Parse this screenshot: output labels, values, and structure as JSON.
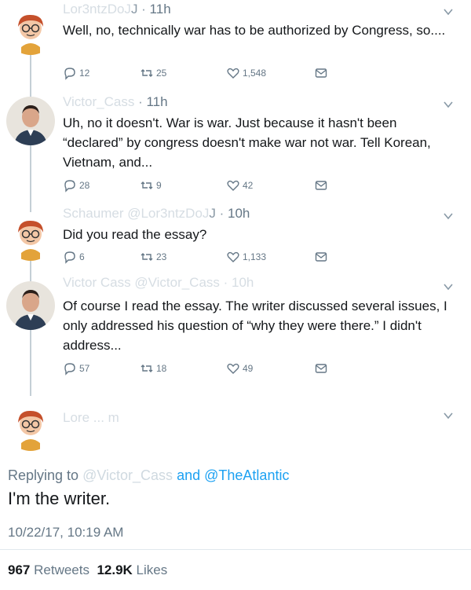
{
  "tweets": [
    {
      "header_blur": "Lor3ntzDoJ",
      "handle_suffix": "J",
      "time": "11h",
      "text": "Well, no, technically war has to be authorized by Congress, so....",
      "replies": "12",
      "retweets": "25",
      "likes": "1,548"
    },
    {
      "header_blur": "Victor_Cass",
      "handle_suffix": "",
      "time": "11h",
      "text": "Uh, no it doesn't. War is war. Just because it hasn't been “declared” by congress doesn't make war not war. Tell Korean, Vietnam, and...",
      "replies": "28",
      "retweets": "9",
      "likes": "42"
    },
    {
      "header_blur": "Schaumer @Lor3ntzDoJ",
      "handle_suffix": "J",
      "time": "10h",
      "text": "Did you read the essay?",
      "replies": "6",
      "retweets": "23",
      "likes": "1,133"
    },
    {
      "header_blur": "Victor Cass @Victor_Cass · 10h",
      "handle_suffix": "",
      "time": "",
      "text": "Of course I read the essay. The writer discussed several issues, I only addressed his question of “why they were there.” I didn't address...",
      "replies": "57",
      "retweets": "18",
      "likes": "49"
    }
  ],
  "main": {
    "header_blur": "Lore ... m",
    "replying_prefix": "Replying to",
    "replying_blur": "@Victor_Cass",
    "replying_and": "and",
    "replying_link": "@TheAtlantic",
    "text": "I'm the writer.",
    "timestamp": "10/22/17, 10:19 AM",
    "retweets_count": "967",
    "retweets_label": "Retweets",
    "likes_count": "12.9K",
    "likes_label": "Likes"
  },
  "colors": {
    "link": "#1da1f2",
    "secondary_text": "#657786",
    "thread_line": "#c4cfd6"
  },
  "icons": [
    "reply-icon",
    "retweet-icon",
    "like-icon",
    "direct-message-icon",
    "chevron-down-icon"
  ]
}
